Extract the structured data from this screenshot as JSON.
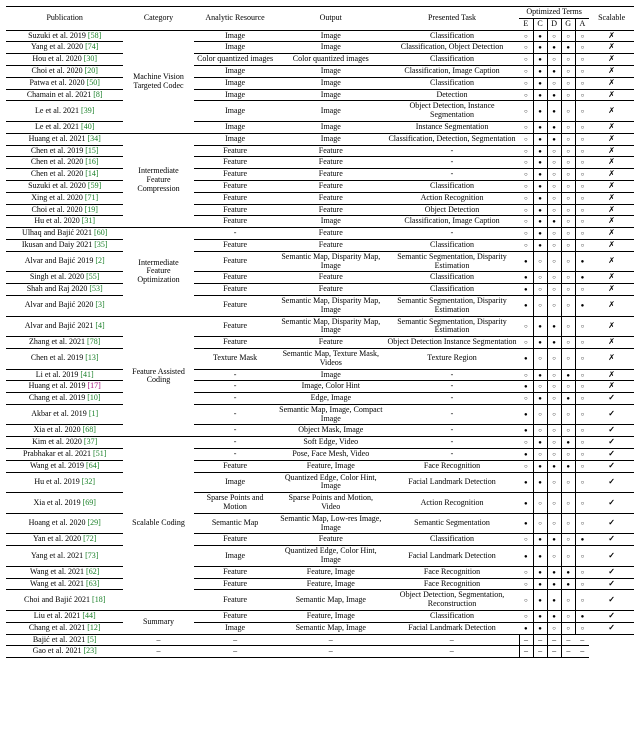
{
  "headers": {
    "publication": "Publication",
    "category": "Category",
    "resource": "Analytic Resource",
    "output": "Output",
    "task": "Presented Task",
    "terms_group": "Optimized Terms",
    "E": "E",
    "C": "C",
    "D": "D",
    "G": "G",
    "A": "A",
    "scalable": "Scalable"
  },
  "categories": [
    {
      "name": "Machine Vision Targeted Codec",
      "span": 8
    },
    {
      "name": "Intermediate Feature Compression",
      "span": 8
    },
    {
      "name": "Intermediate Feature Optimization",
      "span": 6
    },
    {
      "name": "Feature Assisted Coding",
      "span": 8
    },
    {
      "name": "Scalable Coding",
      "span": 11
    },
    {
      "name": "Summary",
      "span": 2
    }
  ],
  "rows": [
    {
      "pub": "Suzuki et al. 2019",
      "ref": "[58]",
      "res": "Image",
      "out": "Image",
      "task": "Classification",
      "opt": [
        "o",
        "f",
        "o",
        "o",
        "o"
      ],
      "sc": "x"
    },
    {
      "pub": "Yang et al. 2020",
      "ref": "[74]",
      "res": "Image",
      "out": "Image",
      "task": "Classification, Object Detection",
      "opt": [
        "o",
        "f",
        "f",
        "f",
        "o"
      ],
      "sc": "x"
    },
    {
      "pub": "Hou et al. 2020",
      "ref": "[30]",
      "res": "Color quantized images",
      "out": "Color quantized images",
      "task": "Classification",
      "opt": [
        "o",
        "f",
        "o",
        "o",
        "o"
      ],
      "sc": "x"
    },
    {
      "pub": "Choi et al. 2020",
      "ref": "[20]",
      "res": "Image",
      "out": "Image",
      "task": "Classification, Image Caption",
      "opt": [
        "o",
        "f",
        "f",
        "o",
        "o"
      ],
      "sc": "x"
    },
    {
      "pub": "Patwa et al. 2020",
      "ref": "[50]",
      "res": "Image",
      "out": "Image",
      "task": "Classification",
      "opt": [
        "o",
        "f",
        "o",
        "o",
        "o"
      ],
      "sc": "x"
    },
    {
      "pub": "Chamain et al. 2021",
      "ref": "[8]",
      "res": "Image",
      "out": "Image",
      "task": "Detection",
      "opt": [
        "o",
        "f",
        "f",
        "o",
        "o"
      ],
      "sc": "x"
    },
    {
      "pub": "Le et al. 2021",
      "ref": "[39]",
      "res": "Image",
      "out": "Image",
      "task": "Object Detection, Instance Segmentation",
      "opt": [
        "o",
        "f",
        "f",
        "o",
        "o"
      ],
      "sc": "x"
    },
    {
      "pub": "Le et al. 2021",
      "ref": "[40]",
      "res": "Image",
      "out": "Image",
      "task": "Instance Segmentation",
      "opt": [
        "o",
        "f",
        "f",
        "o",
        "o"
      ],
      "sc": "x"
    },
    {
      "pub": "Huang et al. 2021",
      "ref": "[34]",
      "res": "Image",
      "out": "Image",
      "task": "Classification, Detection, Segmentation",
      "opt": [
        "o",
        "f",
        "f",
        "o",
        "o"
      ],
      "sc": "x",
      "thick": true
    },
    {
      "pub": "Chen et al. 2019",
      "ref": "[15]",
      "res": "Feature",
      "out": "Feature",
      "task": "-",
      "opt": [
        "o",
        "f",
        "o",
        "o",
        "o"
      ],
      "sc": "x"
    },
    {
      "pub": "Chen et al. 2020",
      "ref": "[16]",
      "res": "Feature",
      "out": "Feature",
      "task": "-",
      "opt": [
        "o",
        "f",
        "o",
        "o",
        "o"
      ],
      "sc": "x"
    },
    {
      "pub": "Chen et al. 2020",
      "ref": "[14]",
      "res": "Feature",
      "out": "Feature",
      "task": "-",
      "opt": [
        "o",
        "f",
        "o",
        "o",
        "o"
      ],
      "sc": "x"
    },
    {
      "pub": "Suzuki et al. 2020",
      "ref": "[59]",
      "res": "Feature",
      "out": "Feature",
      "task": "Classification",
      "opt": [
        "o",
        "f",
        "o",
        "o",
        "o"
      ],
      "sc": "x"
    },
    {
      "pub": "Xing et al. 2020",
      "ref": "[71]",
      "res": "Feature",
      "out": "Feature",
      "task": "Action Recognition",
      "opt": [
        "o",
        "f",
        "o",
        "o",
        "o"
      ],
      "sc": "x"
    },
    {
      "pub": "Choi et al. 2020",
      "ref": "[19]",
      "res": "Feature",
      "out": "Feature",
      "task": "Object Detection",
      "opt": [
        "o",
        "f",
        "o",
        "o",
        "o"
      ],
      "sc": "x"
    },
    {
      "pub": "Hu et al. 2020",
      "ref": "[31]",
      "res": "Feature",
      "out": "Image",
      "task": "Classification, Image Caption",
      "opt": [
        "o",
        "f",
        "f",
        "o",
        "o"
      ],
      "sc": "x"
    },
    {
      "pub": "Ulhaq and Bajić 2021",
      "ref": "[60]",
      "res": "-",
      "out": "Feature",
      "task": "-",
      "opt": [
        "o",
        "f",
        "o",
        "o",
        "o"
      ],
      "sc": "x"
    },
    {
      "pub": "Ikusan and Daiy 2021",
      "ref": "[35]",
      "res": "Feature",
      "out": "Feature",
      "task": "Classification",
      "opt": [
        "o",
        "f",
        "o",
        "o",
        "o"
      ],
      "sc": "x",
      "thick": true
    },
    {
      "pub": "Alvar and Bajić 2019",
      "ref": "[2]",
      "res": "Feature",
      "out": "Semantic Map, Disparity Map, Image",
      "task": "Semantic Segmentation, Disparity Estimation",
      "opt": [
        "f",
        "o",
        "o",
        "o",
        "f"
      ],
      "sc": "x"
    },
    {
      "pub": "Singh et al. 2020",
      "ref": "[55]",
      "res": "Feature",
      "out": "Feature",
      "task": "Classification",
      "opt": [
        "f",
        "o",
        "o",
        "o",
        "f"
      ],
      "sc": "x"
    },
    {
      "pub": "Shah and Raj 2020",
      "ref": "[53]",
      "res": "Feature",
      "out": "Feature",
      "task": "Classification",
      "opt": [
        "f",
        "o",
        "o",
        "o",
        "o"
      ],
      "sc": "x"
    },
    {
      "pub": "Alvar and Bajić 2020",
      "ref": "[3]",
      "res": "Feature",
      "out": "Semantic Map, Disparity Map, Image",
      "task": "Semantic Segmentation, Disparity Estimation",
      "opt": [
        "f",
        "o",
        "o",
        "o",
        "f"
      ],
      "sc": "x"
    },
    {
      "pub": "Alvar and Bajić 2021",
      "ref": "[4]",
      "res": "Feature",
      "out": "Semantic Map, Disparity Map, Image",
      "task": "Semantic Segmentation, Disparity Estimation",
      "opt": [
        "o",
        "f",
        "f",
        "o",
        "o"
      ],
      "sc": "x"
    },
    {
      "pub": "Zhang et al. 2021",
      "ref": "[78]",
      "res": "Feature",
      "out": "Feature",
      "task": "Object Detection Instance Segmentation",
      "opt": [
        "o",
        "f",
        "f",
        "o",
        "o"
      ],
      "sc": "x",
      "thick": true
    },
    {
      "pub": "Chen et al. 2019",
      "ref": "[13]",
      "res": "Texture Mask",
      "out": "Semantic Map, Texture Mask, Videos",
      "task": "Texture Region",
      "opt": [
        "f",
        "o",
        "o",
        "o",
        "o"
      ],
      "sc": "x"
    },
    {
      "pub": "Li et al. 2019",
      "ref": "[41]",
      "res": "-",
      "out": "Image",
      "task": "-",
      "opt": [
        "o",
        "f",
        "o",
        "f",
        "o"
      ],
      "sc": "x"
    },
    {
      "pub": "Huang et al. 2019",
      "ref": "[17]",
      "refcolor": "m",
      "res": "-",
      "out": "Image, Color Hint",
      "task": "-",
      "opt": [
        "f",
        "o",
        "o",
        "o",
        "o"
      ],
      "sc": "x"
    },
    {
      "pub": "Chang et al. 2019",
      "ref": "[10]",
      "res": "-",
      "out": "Edge, Image",
      "task": "-",
      "opt": [
        "o",
        "f",
        "o",
        "f",
        "o"
      ],
      "sc": "c"
    },
    {
      "pub": "Akbar et al. 2019",
      "ref": "[1]",
      "res": "-",
      "out": "Semantic Map, Image, Compact Image",
      "task": "-",
      "opt": [
        "f",
        "o",
        "o",
        "o",
        "o"
      ],
      "sc": "c"
    },
    {
      "pub": "Xia et al. 2020",
      "ref": "[68]",
      "res": "-",
      "out": "Object Mask, Image",
      "task": "-",
      "opt": [
        "f",
        "o",
        "o",
        "o",
        "o"
      ],
      "sc": "c"
    },
    {
      "pub": "Kim et al. 2020",
      "ref": "[37]",
      "res": "-",
      "out": "Soft Edge, Video",
      "task": "-",
      "opt": [
        "o",
        "f",
        "o",
        "f",
        "o"
      ],
      "sc": "c"
    },
    {
      "pub": "Prabhakar et al. 2021",
      "ref": "[51]",
      "res": "-",
      "out": "Pose, Face Mesh, Video",
      "task": "-",
      "opt": [
        "f",
        "o",
        "o",
        "o",
        "o"
      ],
      "sc": "c",
      "thick": true
    },
    {
      "pub": "Wang et al. 2019",
      "ref": "[64]",
      "res": "Feature",
      "out": "Feature, Image",
      "task": "Face Recognition",
      "opt": [
        "o",
        "f",
        "f",
        "f",
        "o"
      ],
      "sc": "c"
    },
    {
      "pub": "Hu et al. 2019",
      "ref": "[32]",
      "res": "Image",
      "out": "Quantized Edge, Color Hint, Image",
      "task": "Facial Landmark Detection",
      "opt": [
        "f",
        "f",
        "o",
        "o",
        "o"
      ],
      "sc": "c"
    },
    {
      "pub": "Xia et al. 2019",
      "ref": "[69]",
      "res": "Sparse Points and Motion",
      "out": "Sparse Points and Motion, Video",
      "task": "Action Recognition",
      "opt": [
        "f",
        "o",
        "o",
        "o",
        "o"
      ],
      "sc": "c"
    },
    {
      "pub": "Hoang et al. 2020",
      "ref": "[29]",
      "res": "Semantic Map",
      "out": "Semantic Map, Low-res Image, Image",
      "task": "Semantic Segmentation",
      "opt": [
        "f",
        "o",
        "o",
        "o",
        "o"
      ],
      "sc": "c"
    },
    {
      "pub": "Yan et al. 2020",
      "ref": "[72]",
      "res": "Feature",
      "out": "Feature",
      "task": "Classification",
      "opt": [
        "o",
        "f",
        "f",
        "o",
        "f"
      ],
      "sc": "c"
    },
    {
      "pub": "Yang et al. 2021",
      "ref": "[73]",
      "res": "Image",
      "out": "Quantized Edge, Color Hint, Image",
      "task": "Facial Landmark Detection",
      "opt": [
        "f",
        "f",
        "o",
        "o",
        "o"
      ],
      "sc": "c"
    },
    {
      "pub": "Wang et al. 2021",
      "ref": "[62]",
      "res": "Feature",
      "out": "Feature, Image",
      "task": "Face Recognition",
      "opt": [
        "o",
        "f",
        "f",
        "f",
        "o"
      ],
      "sc": "c"
    },
    {
      "pub": "Wang et al. 2021",
      "ref": "[63]",
      "res": "Feature",
      "out": "Feature, Image",
      "task": "Face Recognition",
      "opt": [
        "o",
        "f",
        "f",
        "f",
        "o"
      ],
      "sc": "c"
    },
    {
      "pub": "Choi and Bajić 2021",
      "ref": "[18]",
      "res": "Feature",
      "out": "Semantic Map, Image",
      "task": "Object Detection, Segmentation, Reconstruction",
      "opt": [
        "o",
        "f",
        "f",
        "o",
        "o"
      ],
      "sc": "c"
    },
    {
      "pub": "Liu et al. 2021",
      "ref": "[44]",
      "res": "Feature",
      "out": "Feature, Image",
      "task": "Classification",
      "opt": [
        "o",
        "f",
        "f",
        "o",
        "f"
      ],
      "sc": "c"
    },
    {
      "pub": "Chang et al. 2021",
      "ref": "[12]",
      "res": "Image",
      "out": "Semantic Map, Image",
      "task": "Facial Landmark Detection",
      "opt": [
        "f",
        "f",
        "o",
        "o",
        "o"
      ],
      "sc": "c",
      "thick": true
    },
    {
      "pub": "Bajić et al. 2021",
      "ref": "[5]",
      "res": "–",
      "out": "–",
      "task": "–",
      "opt": [
        "-",
        "-",
        "-",
        "-",
        "-"
      ],
      "sc": "-"
    },
    {
      "pub": "Gao et al. 2021",
      "ref": "[23]",
      "res": "–",
      "out": "–",
      "task": "–",
      "opt": [
        "-",
        "-",
        "-",
        "-",
        "-"
      ],
      "sc": "-"
    }
  ]
}
